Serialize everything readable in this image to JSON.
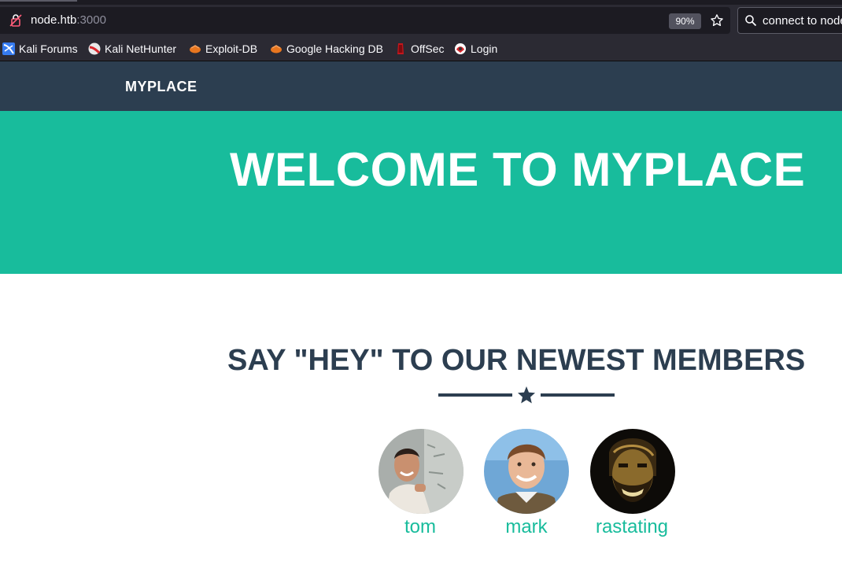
{
  "browser": {
    "url_host": "node.htb",
    "url_port": ":3000",
    "zoom": "90%",
    "search_text": "connect to node",
    "bookmarks": [
      {
        "label": "Kali Forums",
        "icon": "kali-forums-icon"
      },
      {
        "label": "Kali NetHunter",
        "icon": "kali-nethunter-icon"
      },
      {
        "label": "Exploit-DB",
        "icon": "exploit-db-icon"
      },
      {
        "label": "Google Hacking DB",
        "icon": "google-hacking-db-icon"
      },
      {
        "label": "OffSec",
        "icon": "offsec-icon"
      },
      {
        "label": "Login",
        "icon": "login-icon"
      }
    ]
  },
  "site": {
    "brand": "MYPLACE",
    "hero_title": "WELCOME TO MYPLACE",
    "section_title": "SAY \"HEY\" TO OUR NEWEST MEMBERS",
    "members": [
      {
        "name": "tom",
        "avatar": "tom-avatar"
      },
      {
        "name": "mark",
        "avatar": "mark-avatar"
      },
      {
        "name": "rastating",
        "avatar": "rastating-avatar"
      }
    ]
  },
  "colors": {
    "navbar": "#2c3e50",
    "hero": "#18bc9c",
    "accent": "#18bc9c",
    "heading": "#2c3e50",
    "browser_toolbar": "#2b2a33"
  }
}
